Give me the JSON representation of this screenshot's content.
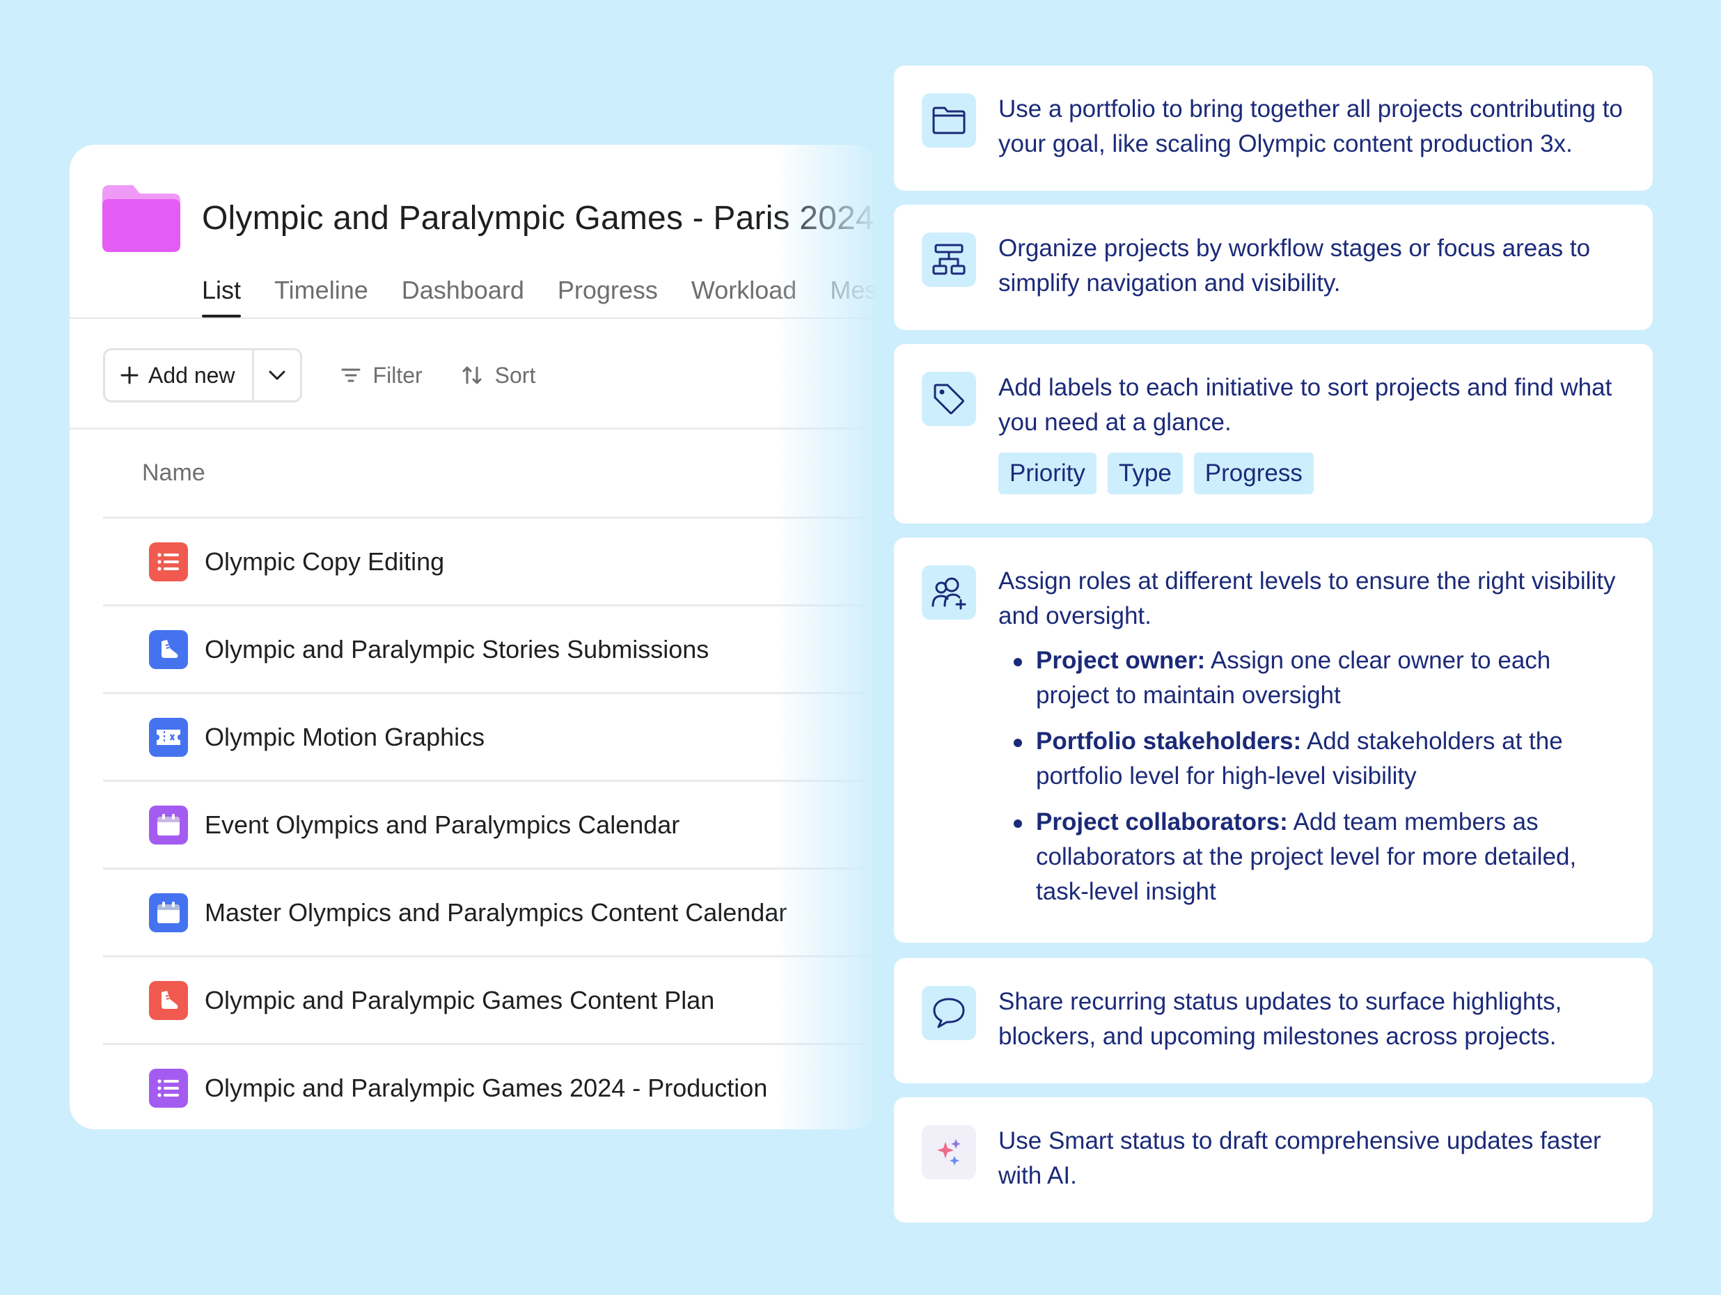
{
  "portfolio": {
    "title": "Olympic and Paralympic Games - Paris 2024",
    "tabs": [
      "List",
      "Timeline",
      "Dashboard",
      "Progress",
      "Workload",
      "Messages"
    ],
    "toolbar": {
      "add_new": "Add new",
      "filter": "Filter",
      "sort": "Sort"
    },
    "column_header": "Name",
    "rows": [
      {
        "label": "Olympic Copy Editing",
        "icon": "list-icon",
        "color": "#f05a4f"
      },
      {
        "label": "Olympic and Paralympic Stories Submissions",
        "icon": "shoe-icon",
        "color": "#4573f0"
      },
      {
        "label": "Olympic Motion Graphics",
        "icon": "ticket-icon",
        "color": "#4573f0"
      },
      {
        "label": "Event Olympics and Paralympics Calendar",
        "icon": "calendar-icon",
        "color": "#a45cf0"
      },
      {
        "label": "Master Olympics and Paralympics Content Calendar",
        "icon": "calendar-icon",
        "color": "#4573f0"
      },
      {
        "label": "Olympic and Paralympic Games Content Plan",
        "icon": "shoe-icon",
        "color": "#f05a4f"
      },
      {
        "label": "Olympic and Paralympic Games 2024 - Production",
        "icon": "list-icon",
        "color": "#a45cf0"
      }
    ],
    "folder_color": "#e65cf5"
  },
  "cards": {
    "portfolio": {
      "icon": "folder-icon",
      "text": "Use a portfolio to bring together all projects contributing to your goal, like scaling Olympic content production 3x."
    },
    "organize": {
      "icon": "workflow-icon",
      "text": "Organize projects by workflow stages or focus areas to simplify navigation and visibility."
    },
    "labels": {
      "icon": "tag-icon",
      "text": "Add labels to each initiative to sort projects and find what you need at a glance.",
      "tags": [
        "Priority",
        "Type",
        "Progress"
      ]
    },
    "roles": {
      "icon": "add-people-icon",
      "text": "Assign roles at different levels to ensure the right visibility and oversight.",
      "bullets": [
        {
          "bold": "Project owner:",
          "text": " Assign one clear owner to each project to maintain oversight"
        },
        {
          "bold": "Portfolio stakeholders:",
          "text": " Add stakeholders at the portfolio level for high-level visibility"
        },
        {
          "bold": "Project collaborators:",
          "text": " Add team members as collaborators at the project level for more detailed, task-level insight"
        }
      ]
    },
    "status": {
      "icon": "speech-bubble-icon",
      "text": "Share recurring status updates to surface highlights, blockers, and upcoming milestones across projects."
    },
    "smart": {
      "icon": "sparkle-icon",
      "text": "Use Smart status to draft comprehensive updates faster with AI."
    }
  },
  "colors": {
    "background": "#cdeefd",
    "card_text": "#1b2a78",
    "icon_tile": "#cdeefd"
  }
}
